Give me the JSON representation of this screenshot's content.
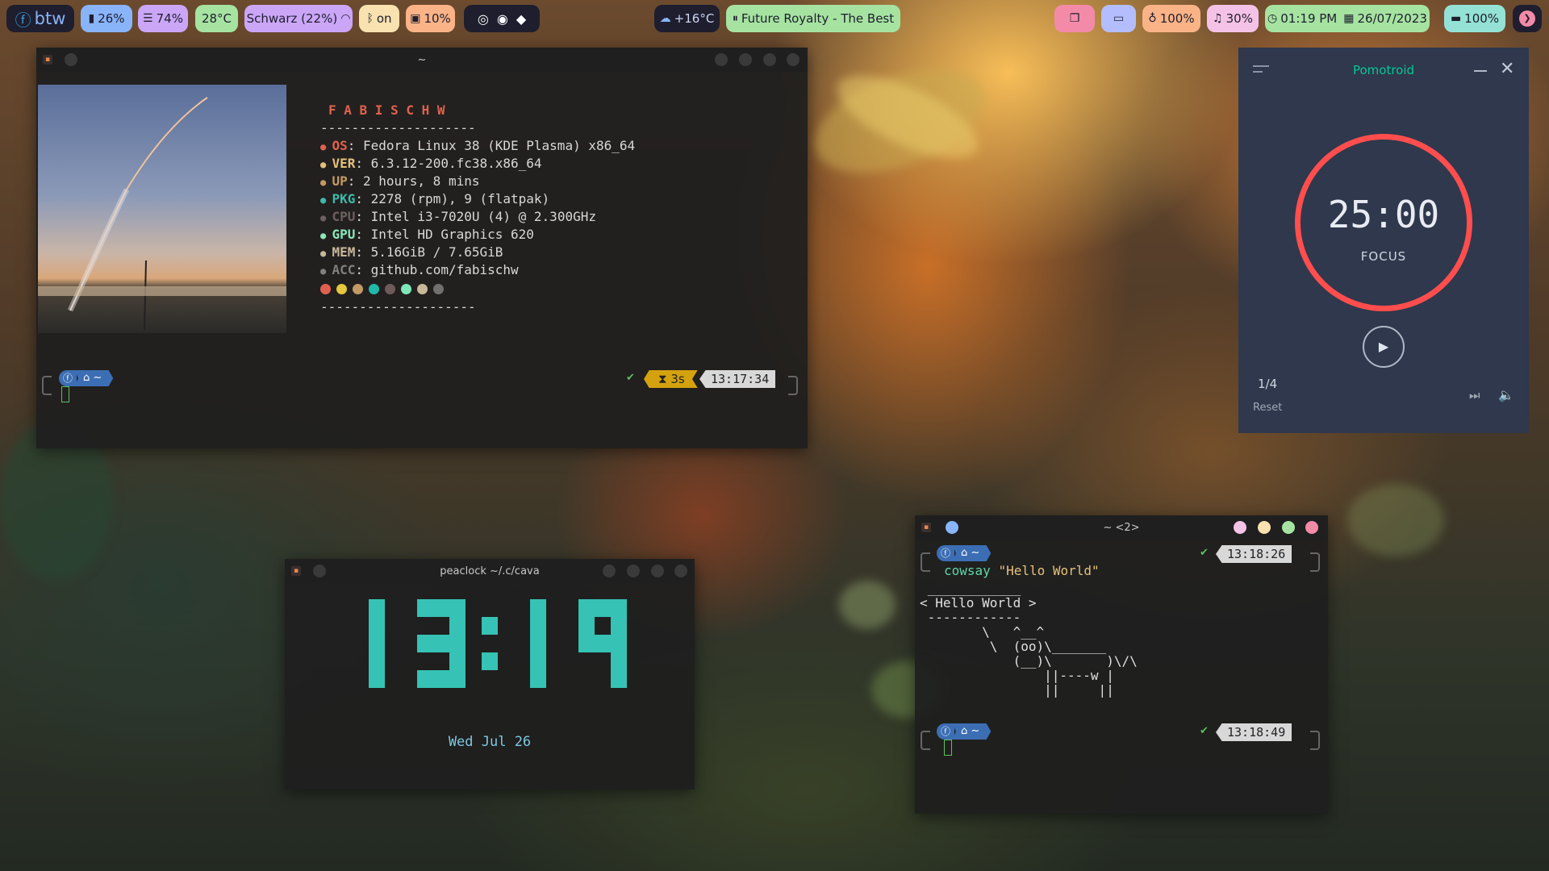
{
  "topbar": {
    "distro": "btw",
    "battery_level": "26%",
    "mem": "74%",
    "temp": "28°C",
    "wifi": "Schwarz (22%)",
    "bluetooth": "on",
    "disk": "10%",
    "weather": "+16°C",
    "media": "Future Royalty - The Best",
    "brightness": "100%",
    "volume": "30%",
    "time": "01:19 PM",
    "date": "26/07/2023",
    "battery": "100%",
    "colors": {
      "battery_level": "#89b4fa",
      "mem": "#cba6f7",
      "temp": "#a6e3a1",
      "wifi": "#cba6f7",
      "bluetooth": "#f9e2af",
      "disk": "#fab387",
      "media": "#a6e3a1",
      "w1": "#f38ba8",
      "w2": "#b4befe",
      "brightness": "#fab387",
      "volume": "#f5c2e7",
      "clock": "#a6e3a1",
      "battery": "#94e2d5"
    }
  },
  "fetch_window": {
    "title": "~",
    "username": "F A B I S C H W",
    "separator": "--------------------",
    "rows": [
      {
        "label": "OS",
        "value": "Fedora Linux 38 (KDE Plasma) x86_64",
        "color": "#e0614f"
      },
      {
        "label": "VER",
        "value": "6.3.12-200.fc38.x86_64",
        "color": "#e5c07b"
      },
      {
        "label": "UP",
        "value": "2 hours, 8 mins",
        "color": "#c39a64"
      },
      {
        "label": "PKG",
        "value": "2278 (rpm), 9 (flatpak)",
        "color": "#3fb9a9"
      },
      {
        "label": "CPU",
        "value": "Intel i3-7020U (4) @ 2.300GHz",
        "color": "#6e6060"
      },
      {
        "label": "GPU",
        "value": "Intel HD Graphics 620",
        "color": "#8ae6b8"
      },
      {
        "label": "MEM",
        "value": "5.16GiB / 7.65GiB",
        "color": "#c8b89a"
      },
      {
        "label": "ACC",
        "value": "github.com/fabischw",
        "color": "#808080"
      }
    ],
    "palette": [
      "#e0614f",
      "#e5c83b",
      "#c39a64",
      "#1fb9a9",
      "#6e5a5a",
      "#7fe6b8",
      "#c8b89a",
      "#707070"
    ],
    "prompt_home": "~",
    "duration": "3s",
    "time": "13:17:34"
  },
  "clock_window": {
    "title": "peaclock ~/.c/cava",
    "time": "13:19",
    "date": "Wed Jul 26"
  },
  "cowsay_window": {
    "title": "~ <2>",
    "time1": "13:18:26",
    "command_name": "cowsay",
    "command_arg": "\"Hello World\"",
    "output": " ____________\n< Hello World >\n ------------\n        \\   ^__^\n         \\  (oo)\\_______\n            (__)\\       )\\/\\\n                ||----w |\n                ||     ||",
    "time2": "13:18:49"
  },
  "pomodoro": {
    "title": "Pomotroid",
    "timer": "25:00",
    "mode": "FOCUS",
    "round": "1/4",
    "reset": "Reset"
  }
}
